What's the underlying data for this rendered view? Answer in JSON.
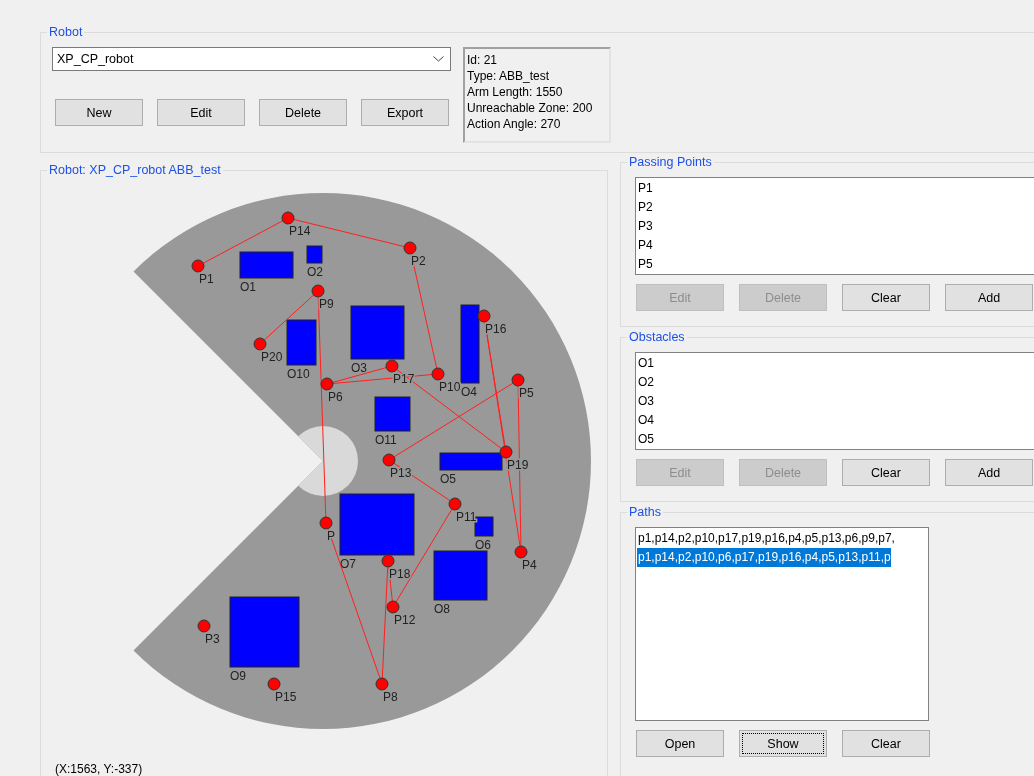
{
  "robot_group": {
    "title": "Robot",
    "selector": {
      "value": "XP_CP_robot"
    },
    "buttons": [
      "New",
      "Edit",
      "Delete",
      "Export"
    ],
    "info": [
      "Id: 21",
      "Type: ABB_test",
      "Arm Length: 1550",
      "Unreachable Zone: 200",
      "Action Angle: 270"
    ]
  },
  "canvas_group": {
    "title": "Robot: XP_CP_robot ABB_test",
    "points": [
      {
        "label": "P14"
      },
      {
        "label": "P2"
      },
      {
        "label": "P1"
      },
      {
        "label": "P9"
      },
      {
        "label": "P16"
      },
      {
        "label": "P20"
      },
      {
        "label": "P17"
      },
      {
        "label": "P10"
      },
      {
        "label": "P5"
      },
      {
        "label": "P6"
      },
      {
        "label": "P19"
      },
      {
        "label": "P13"
      },
      {
        "label": "P11"
      },
      {
        "label": "P"
      },
      {
        "label": "P4"
      },
      {
        "label": "P18"
      },
      {
        "label": "P12"
      },
      {
        "label": "P3"
      },
      {
        "label": "P15"
      },
      {
        "label": "P8"
      }
    ],
    "obstacles": [
      {
        "label": "O2"
      },
      {
        "label": "O1"
      },
      {
        "label": "O4"
      },
      {
        "label": "O3"
      },
      {
        "label": "O10"
      },
      {
        "label": "O11"
      },
      {
        "label": "O5"
      },
      {
        "label": "O7"
      },
      {
        "label": "O6"
      },
      {
        "label": "O8"
      },
      {
        "label": "O9"
      }
    ],
    "coordinates": "(X:1563, Y:-337)"
  },
  "passing_points": {
    "title": "Passing Points",
    "items": [
      "P1",
      "P2",
      "P3",
      "P4",
      "P5"
    ],
    "buttons": [
      {
        "label": "Edit",
        "disabled": true
      },
      {
        "label": "Delete",
        "disabled": true
      },
      {
        "label": "Clear",
        "disabled": false
      },
      {
        "label": "Add",
        "disabled": false
      }
    ]
  },
  "obstacles": {
    "title": "Obstacles",
    "items": [
      "O1",
      "O2",
      "O3",
      "O4",
      "O5"
    ],
    "buttons": [
      {
        "label": "Edit",
        "disabled": true
      },
      {
        "label": "Delete",
        "disabled": true
      },
      {
        "label": "Clear",
        "disabled": false
      },
      {
        "label": "Add",
        "disabled": false
      }
    ]
  },
  "paths": {
    "title": "Paths",
    "items": [
      {
        "text": "p1,p14,p2,p10,p17,p19,p16,p4,p5,p13,p6,p9,p7,",
        "selected": false
      },
      {
        "text": "p1,p14,p2,p10,p6,p17,p19,p16,p4,p5,p13,p11,p",
        "selected": true
      }
    ],
    "buttons": [
      {
        "label": "Open",
        "focused": false
      },
      {
        "label": "Show",
        "focused": true
      },
      {
        "label": "Clear",
        "focused": false
      }
    ]
  }
}
